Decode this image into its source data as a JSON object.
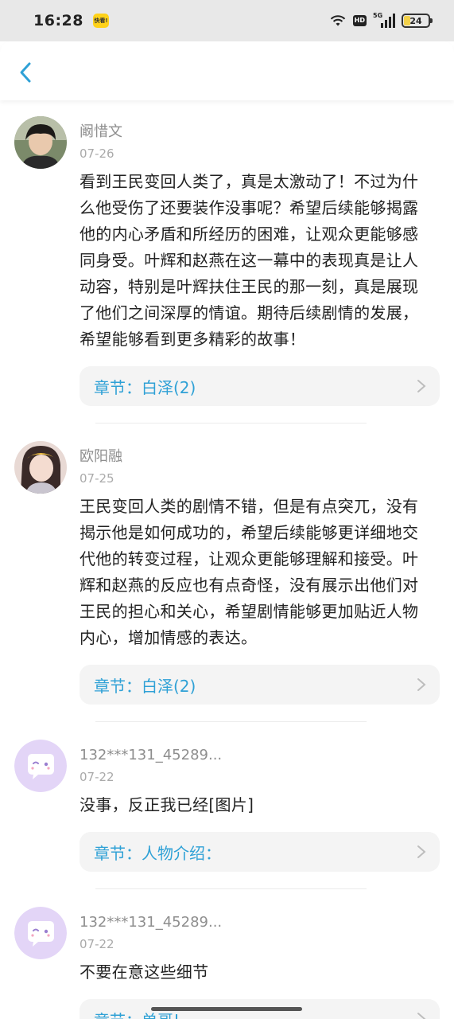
{
  "status_bar": {
    "time": "16:28",
    "app_badge": "快看!",
    "hd": "HD",
    "network": "5G",
    "battery_level": "24"
  },
  "nav": {
    "back_icon": "chevron-left-icon",
    "accent_color": "#2fa1d6"
  },
  "comments": [
    {
      "username": "阚惜文",
      "date": "07-26",
      "avatar": "photo-avatar",
      "content": "看到王民变回人类了，真是太激动了！不过为什么他受伤了还要装作没事呢？希望后续能够揭露他的内心矛盾和所经历的困难，让观众更能够感同身受。叶辉和赵燕在这一幕中的表现真是让人动容，特别是叶辉扶住王民的那一刻，真是展现了他们之间深厚的情谊。期待后续剧情的发展，希望能够看到更多精彩的故事！",
      "chapter": "章节：白泽(2)"
    },
    {
      "username": "欧阳融",
      "date": "07-25",
      "avatar": "photo-avatar",
      "content": "王民变回人类的剧情不错，但是有点突兀，没有揭示他是如何成功的，希望后续能够更详细地交代他的转变过程，让观众更能够理解和接受。叶辉和赵燕的反应也有点奇怪，没有展示出他们对王民的担心和关心，希望剧情能够更加贴近人物内心，增加情感的表达。",
      "chapter": "章节：白泽(2)"
    },
    {
      "username": "132***131_45289...",
      "date": "07-22",
      "avatar": "default-chat-avatar",
      "content": "没事，反正我已经[图片]",
      "chapter": "章节：人物介绍："
    },
    {
      "username": "132***131_45289...",
      "date": "07-22",
      "avatar": "default-chat-avatar",
      "content": "不要在意这些细节",
      "chapter": "章节：单哥!"
    }
  ]
}
